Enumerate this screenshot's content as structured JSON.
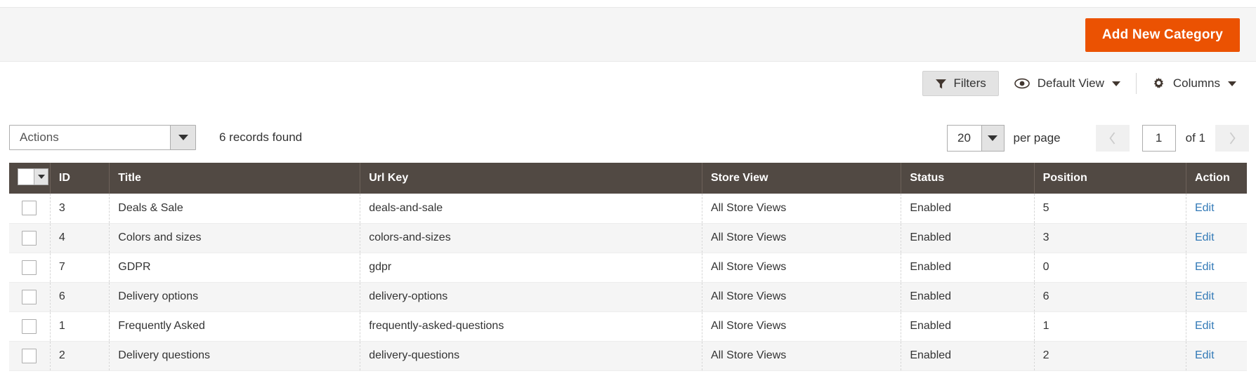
{
  "page_actions": {
    "add_button_label": "Add New Category",
    "accent_color": "#eb5202"
  },
  "toolbar": {
    "filters_label": "Filters",
    "filters_icon": "funnel-icon",
    "view_label": "Default View",
    "view_icon": "eye-icon",
    "columns_label": "Columns",
    "columns_icon": "gear-icon"
  },
  "grid_controls": {
    "actions_label": "Actions",
    "records_found": "6 records found",
    "per_page_value": "20",
    "per_page_label": "per page",
    "page_value": "1",
    "of_total": "of 1",
    "prev_icon": "chevron-left-icon",
    "next_icon": "chevron-right-icon"
  },
  "grid": {
    "header_bg": "#514943",
    "columns": [
      {
        "key": "checkbox",
        "label": ""
      },
      {
        "key": "id",
        "label": "ID"
      },
      {
        "key": "title",
        "label": "Title"
      },
      {
        "key": "url_key",
        "label": "Url Key"
      },
      {
        "key": "store_view",
        "label": "Store View"
      },
      {
        "key": "status",
        "label": "Status"
      },
      {
        "key": "position",
        "label": "Position"
      },
      {
        "key": "action",
        "label": "Action"
      }
    ],
    "rows": [
      {
        "id": "3",
        "title": "Deals & Sale",
        "url_key": "deals-and-sale",
        "store_view": "All Store Views",
        "status": "Enabled",
        "position": "5",
        "action": "Edit"
      },
      {
        "id": "4",
        "title": "Colors and sizes",
        "url_key": "colors-and-sizes",
        "store_view": "All Store Views",
        "status": "Enabled",
        "position": "3",
        "action": "Edit"
      },
      {
        "id": "7",
        "title": "GDPR",
        "url_key": "gdpr",
        "store_view": "All Store Views",
        "status": "Enabled",
        "position": "0",
        "action": "Edit"
      },
      {
        "id": "6",
        "title": "Delivery options",
        "url_key": "delivery-options",
        "store_view": "All Store Views",
        "status": "Enabled",
        "position": "6",
        "action": "Edit"
      },
      {
        "id": "1",
        "title": "Frequently Asked",
        "url_key": "frequently-asked-questions",
        "store_view": "All Store Views",
        "status": "Enabled",
        "position": "1",
        "action": "Edit"
      },
      {
        "id": "2",
        "title": "Delivery questions",
        "url_key": "delivery-questions",
        "store_view": "All Store Views",
        "status": "Enabled",
        "position": "2",
        "action": "Edit"
      }
    ]
  }
}
